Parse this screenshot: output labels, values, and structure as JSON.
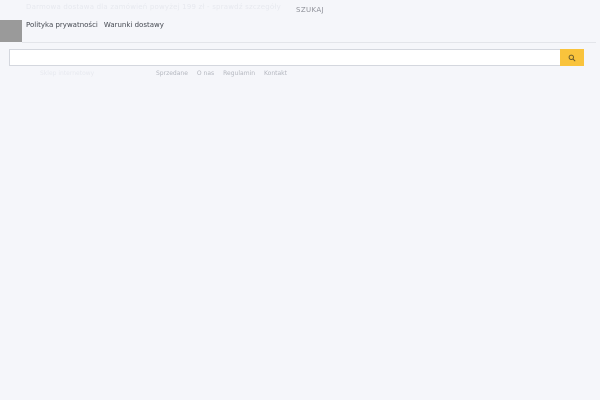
{
  "header": {
    "search_label": "SZUKAJ",
    "promo_text": "Darmowa dostawa dla zamówień powyżej 199 zł - sprawdź szczegóły"
  },
  "top_links": {
    "privacy": "Polityka prywatności",
    "delivery": "Warunki dostawy"
  },
  "search": {
    "value": "",
    "placeholder": "",
    "button_icon": "search-icon"
  },
  "brand": {
    "name": "Sklep internetowy"
  },
  "nav": {
    "items": [
      "Sprzedane",
      "O nas",
      "Regulamin",
      "Kontakt"
    ]
  },
  "colors": {
    "page_background": "#f5f6fa",
    "search_button": "#f9c33c",
    "placeholder_block": "#9a9a9a"
  }
}
